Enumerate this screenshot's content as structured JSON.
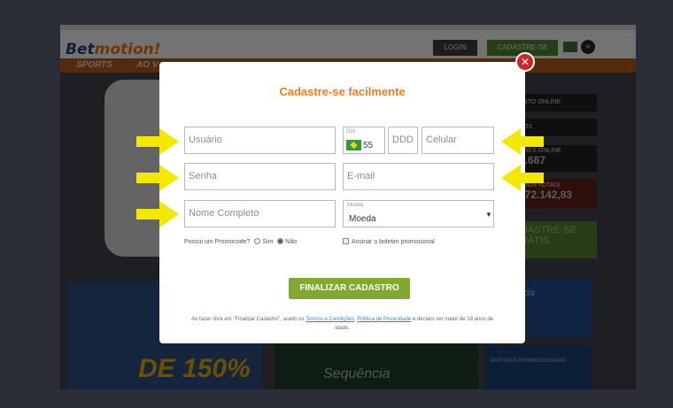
{
  "site": {
    "logo_prefix": "Bet",
    "logo_suffix": "motion!",
    "login_label": "LOGIN",
    "signup_label": "CADASTRE-SE",
    "nav_sports": "SPORTS",
    "nav_live": "AO V",
    "panel_line1": "ENTO ONLINE",
    "panel_line2": "NOS",
    "panel_line3": "ORES ONLINE",
    "panel_value1": "3.687",
    "panel_line4": "ADOS TOTAIS",
    "panel_value2": "972.142,83",
    "green_block": "DASTRE-SE\nRÁTIS",
    "promo_big": "DE 150%",
    "promo_mid": "Sequência",
    "promo_right": "sequência\nhadora",
    "promo_right2": "PARTIDAS PROMOCIONADAS"
  },
  "modal": {
    "title": "Cadastre-se facilmente",
    "username_placeholder": "Usuário",
    "ddi_label": "DDI",
    "ddi_code": "55",
    "ddd_placeholder": "DDD",
    "phone_placeholder": "Celular",
    "password_placeholder": "Senha",
    "email_placeholder": "E-mail",
    "fullname_placeholder": "Nome Completo",
    "currency_label": "Moeda",
    "currency_value": "Moeda",
    "promo_question": "Possui um Promocode?",
    "promo_yes": "Sim",
    "promo_no": "Não",
    "promo_selected": "Não",
    "newsletter_label": "Assinar o boletim promocional",
    "submit_label": "FINALIZAR CADASTRO",
    "legal_prefix": "Ao fazer click em \"Finalizar Cadastro\", aceito os ",
    "legal_terms": "Termos e Condições",
    "legal_sep": ", ",
    "legal_privacy": "Política de Privacidade",
    "legal_suffix": " e declaro ser maior de 18 anos de idade."
  },
  "colors": {
    "title": "#f07d1c",
    "submit": "#82a832",
    "close": "#c8282a",
    "arrow": "#f5e800"
  },
  "icons": {
    "close": "close-icon",
    "arrow": "arrow-right-icon"
  }
}
